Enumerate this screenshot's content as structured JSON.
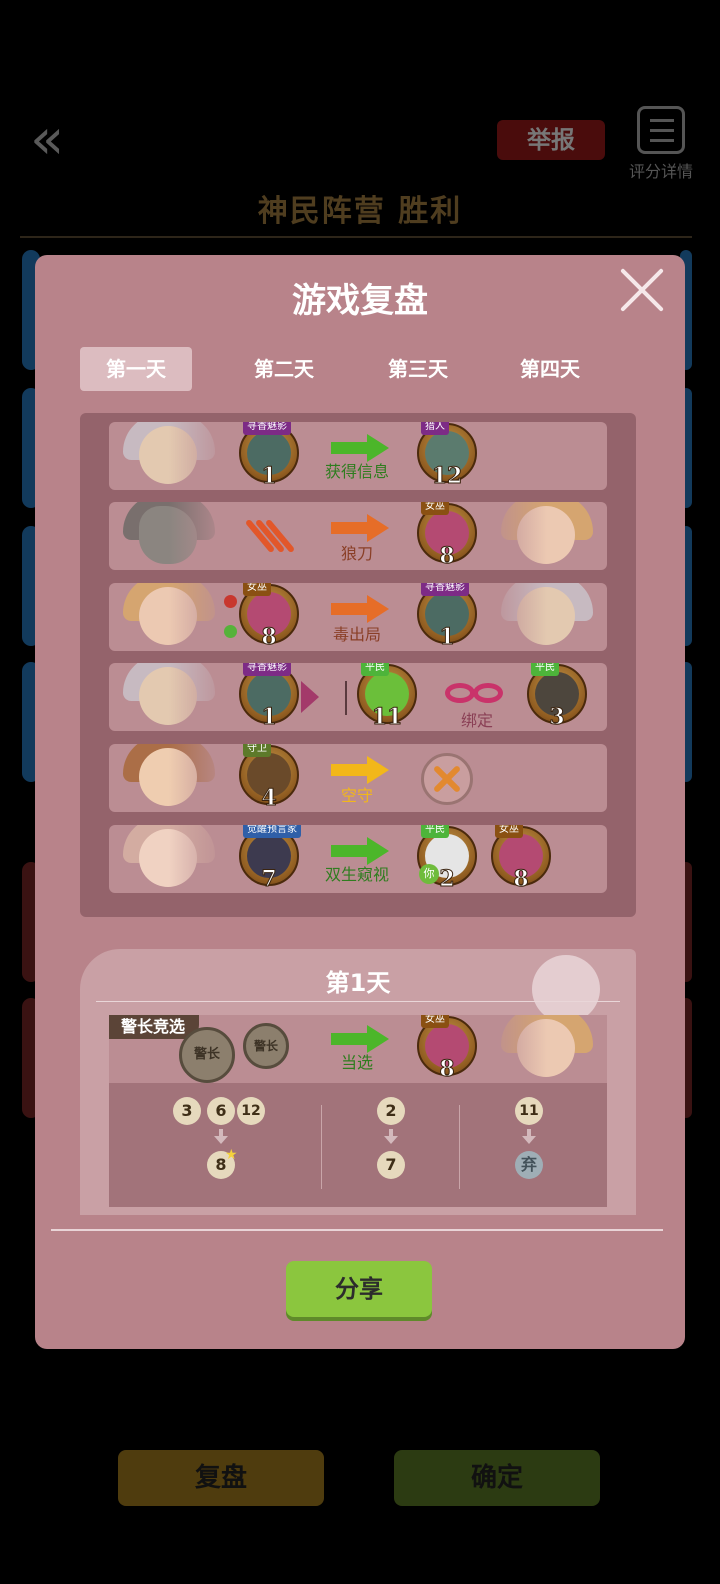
{
  "background": {
    "report_label": "举报",
    "score_detail_label": "评分详情",
    "result_title": "神民阵营  胜利",
    "replay_button": "复盘",
    "confirm_button": "确定"
  },
  "modal": {
    "title": "游戏复盘",
    "tabs": [
      "第一天",
      "第二天",
      "第三天",
      "第四天"
    ],
    "active_tab": "第一天",
    "events": [
      {
        "actor_num": "1",
        "actor_role": "寻香魅影",
        "action": "获得信息",
        "target_num": "12",
        "target_role": "猎人"
      },
      {
        "action": "狼刀",
        "target_num": "8",
        "target_role": "女巫"
      },
      {
        "actor_num": "8",
        "actor_role": "女巫",
        "action": "毒出局",
        "target_num": "1",
        "target_role": "寻香魅影"
      },
      {
        "actor_num": "1",
        "actor_role": "寻香魅影",
        "target_num": "11",
        "target_role": "平民",
        "action": "绑定",
        "target2_num": "3",
        "target2_role": "平民"
      },
      {
        "actor_num": "4",
        "actor_role": "守卫",
        "action": "空守"
      },
      {
        "actor_num": "7",
        "actor_role": "觉醒预言家",
        "action": "双生窥视",
        "target_num": "2",
        "target_role": "平民",
        "you_label": "你",
        "target2_num": "8",
        "target2_role": "女巫"
      }
    ],
    "day_panel": {
      "title": "第1天",
      "sheriff_tag": "警长竞选",
      "badge_big": "警长",
      "badge_small": "警长",
      "action": "当选",
      "winner_num": "8",
      "winner_role": "女巫",
      "votes": {
        "group1_from": [
          "3",
          "6",
          "12"
        ],
        "group1_to": "8",
        "group2_from": [
          "2"
        ],
        "group2_to": "7",
        "group3_from": [
          "11"
        ],
        "group3_to": "弃"
      }
    },
    "share_button": "分享"
  },
  "colors": {
    "modal_bg": "#b8838a",
    "accent_green": "#8bc63e",
    "arrow_green": "#4cb62a",
    "arrow_orange": "#e66d28",
    "arrow_yellow": "#f2b71a"
  }
}
